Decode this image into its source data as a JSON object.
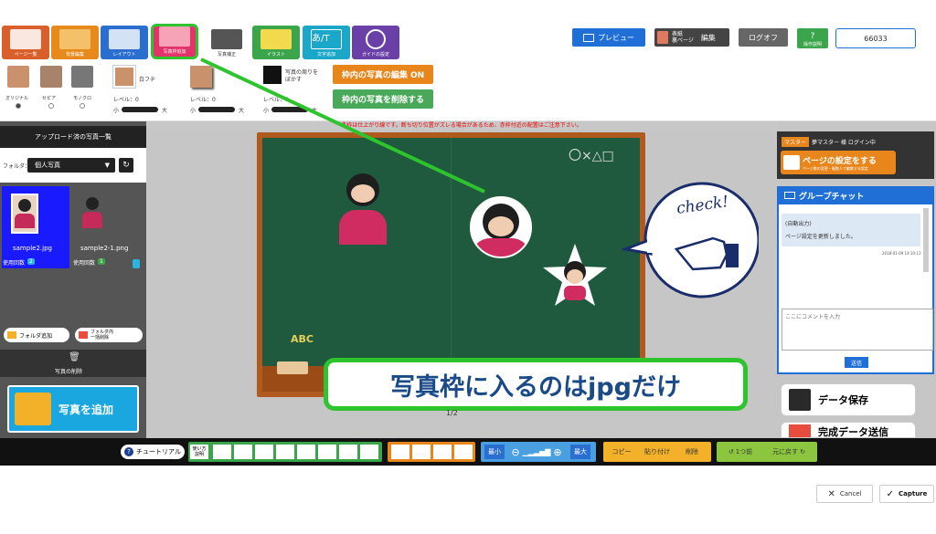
{
  "top": {
    "preview_label": "プレビュー",
    "cover_label": "表紙\n裏ページ",
    "edit_label": "編集",
    "logoff_label": "ログオフ",
    "help_label": "操作説明",
    "code_value": "66033"
  },
  "tabs": [
    {
      "label": "ページ一覧",
      "color": "#d9602a"
    },
    {
      "label": "背景編集",
      "color": "#e88a1b"
    },
    {
      "label": "レイアウト",
      "color": "#2a6fd0"
    },
    {
      "label": "写真枠追加",
      "color": "#e2336b"
    },
    {
      "label": "写真補正",
      "color": "#6b6b6b"
    },
    {
      "label": "イラスト",
      "color": "#3aa54a"
    },
    {
      "label": "文字追加",
      "color": "#1aa7c9"
    },
    {
      "label": "ガイドの設定",
      "color": "#6b3fa8"
    }
  ],
  "tools": {
    "filters": [
      "オリジナル",
      "セピア",
      "モノクロ"
    ],
    "white_edge": "白フチ",
    "level1": "レベル：0",
    "level2": "レベル：0",
    "level3": "レベル：0",
    "small": "小",
    "large": "大",
    "blur_label": "写真の周りを\nぼかす",
    "edit_on": "枠内の写真の編集 ON",
    "delete_photo": "枠内の写真を削除する"
  },
  "notice": "赤枠は仕上がり線です。断ち切り位置がズレる場合があるため、赤枠付近の配置はご注意下さい。",
  "left": {
    "title": "アップロード済の写真一覧",
    "folder_label": "フォルダ：",
    "folder_value": "個人写真",
    "photos": [
      {
        "name": "sample2.jpg",
        "count_label": "使用回数",
        "count": "2"
      },
      {
        "name": "sample2-1.png",
        "count_label": "使用回数",
        "count": "1"
      }
    ],
    "add_folder": "フォルダ追加",
    "folder_delete": "フォルダ内\n一括削除",
    "photo_delete": "写真の削除",
    "add_photo": "写真を追加"
  },
  "canvas": {
    "chalk_text": "〇×△□",
    "page_num": "1/2",
    "check_text": "check!",
    "abc": "ABC"
  },
  "overlay": {
    "caption": "写真枠に入るのはjpgだけ"
  },
  "right": {
    "master_tag": "マスター",
    "login_text": "夢マスター 様 ログイン中",
    "page_setting": "ページの設定をする",
    "page_setting_sub": "ページ数の変更・複数人で編集する設定",
    "chat_title": "グループチャット",
    "chat_sender": "(自動出力)",
    "chat_message": "ページ設定を更新しました。",
    "chat_time": "2018-01-09 14:10:13",
    "comment_placeholder": "ここにコメントを入力",
    "send": "送信",
    "save": "データ保存",
    "complete": "完成データ送信"
  },
  "bottom": {
    "tutorial": "チュートリアル",
    "howto": "使い方\n説明",
    "zoom_min": "最小",
    "zoom_max": "最大",
    "copy": "コピー",
    "paste": "貼り付け",
    "delete": "削除",
    "undo": "1つ前",
    "redo": "元に戻す"
  },
  "footer": {
    "cancel": "Cancel",
    "capture": "Capture"
  }
}
